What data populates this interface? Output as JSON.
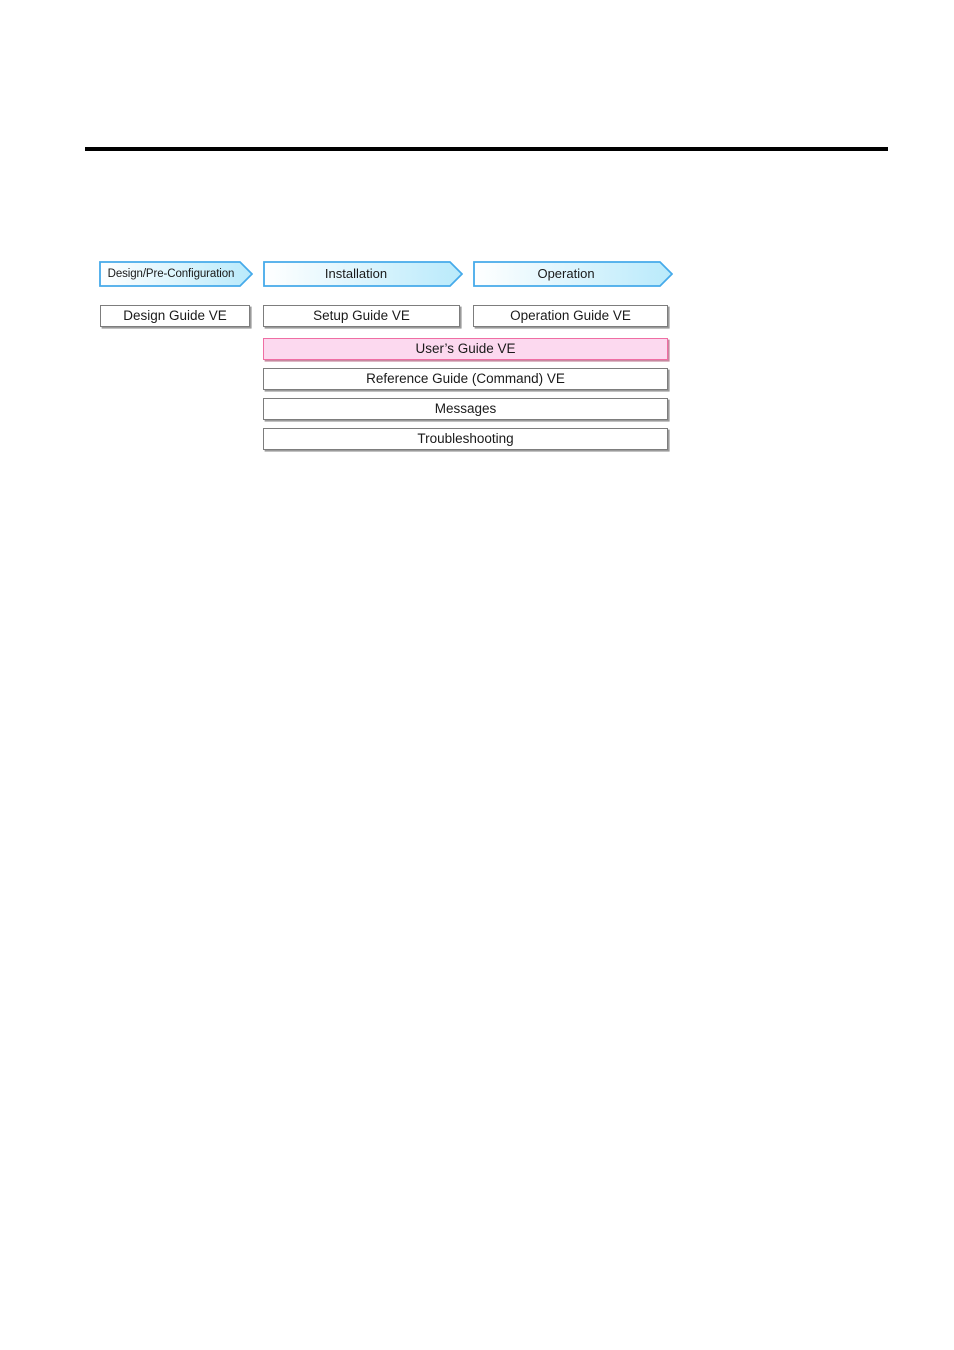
{
  "page": {
    "background_color": "#ffffff",
    "rule_color": "#000000"
  },
  "diagram": {
    "name": "manual-organization-chart",
    "phases": [
      {
        "id": "design",
        "label": "Design/Pre-Configuration",
        "fill_start": "#ffffff",
        "fill_end": "#bdecfb",
        "border_color": "#46aaea"
      },
      {
        "id": "installation",
        "label": "Installation",
        "fill_start": "#ffffff",
        "fill_end": "#bdecfb",
        "border_color": "#46aaea"
      },
      {
        "id": "operation",
        "label": "Operation",
        "fill_start": "#ffffff",
        "fill_end": "#bdecfb",
        "border_color": "#46aaea"
      }
    ],
    "documents": [
      {
        "id": "design-guide-ve",
        "label": "Design Guide VE",
        "column": "design",
        "highlighted": false
      },
      {
        "id": "setup-guide-ve",
        "label": "Setup Guide VE",
        "column": "installation",
        "highlighted": false
      },
      {
        "id": "operation-guide-ve",
        "label": "Operation Guide VE",
        "column": "operation",
        "highlighted": false
      },
      {
        "id": "users-guide-ve",
        "label": "User’s Guide VE",
        "column": "span",
        "highlighted": true
      },
      {
        "id": "reference-guide-cmd",
        "label": "Reference Guide (Command) VE",
        "column": "span",
        "highlighted": false
      },
      {
        "id": "messages",
        "label": "Messages",
        "column": "span",
        "highlighted": false
      },
      {
        "id": "troubleshooting",
        "label": "Troubleshooting",
        "column": "span",
        "highlighted": false
      }
    ],
    "colors": {
      "box_border": "#7d7d7d",
      "box_fill": "#ffffff",
      "box_shadow": "#9a9a9a",
      "highlight_fill": "#fcd9ef",
      "highlight_border": "#ef6ea3",
      "text": "#1a1a1a"
    }
  }
}
